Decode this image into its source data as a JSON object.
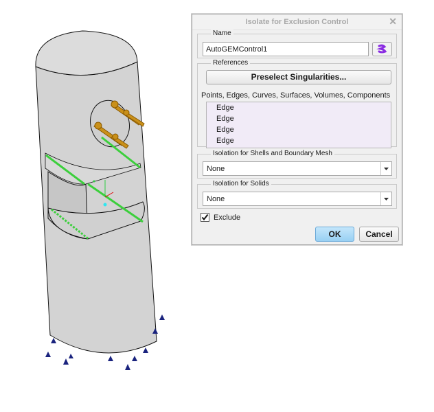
{
  "dialog": {
    "title": "Isolate for Exclusion Control",
    "close_glyph": "✕",
    "name_group": {
      "legend": "Name",
      "value": "AutoGEMControl1"
    },
    "references_group": {
      "legend": "References",
      "preselect_label": "Preselect Singularities...",
      "filter_text": "Points, Edges, Curves, Surfaces, Volumes, Components",
      "items": [
        "Edge",
        "Edge",
        "Edge",
        "Edge"
      ]
    },
    "shells_group": {
      "legend": "Isolation for Shells and Boundary Mesh",
      "value": "None"
    },
    "solids_group": {
      "legend": "Isolation for Solids",
      "value": "None"
    },
    "exclude": {
      "label": "Exclude",
      "checked": true
    },
    "ok_label": "OK",
    "cancel_label": "Cancel"
  },
  "colors": {
    "part_fill": "#d3d3d3",
    "edge_highlight": "#3ccf3c",
    "constraint_marker": "#1a237e",
    "connector": "#b8860b",
    "annotation_red": "#e00000",
    "ok_button": "#a9d9f7",
    "list_bg": "#f1ebf7"
  },
  "icons": [
    "name-picker-icon",
    "checkmark-icon",
    "chevron-down-icon",
    "close-icon",
    "coordinate-system-icon"
  ]
}
